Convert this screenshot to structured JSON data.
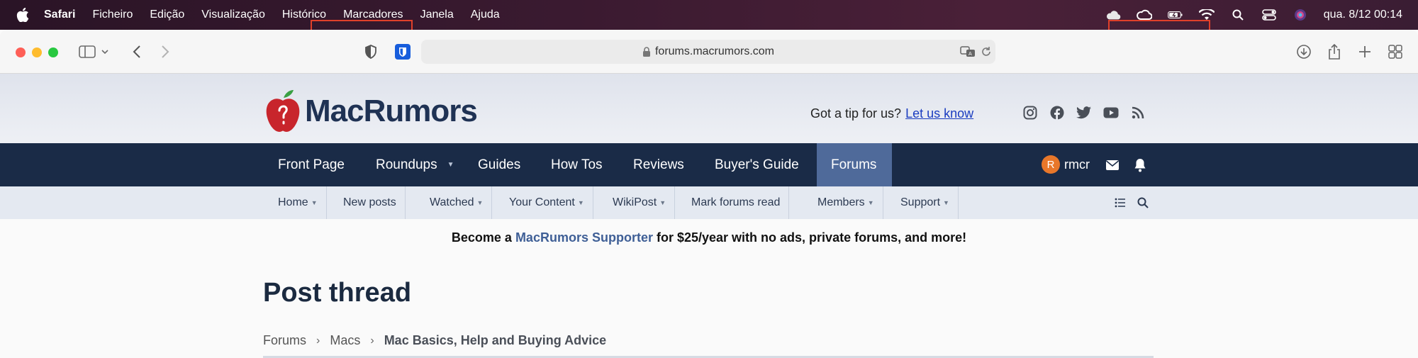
{
  "menubar": {
    "app": "Safari",
    "items": [
      "Ficheiro",
      "Edição",
      "Visualização",
      "Histórico",
      "Marcadores",
      "Janela",
      "Ajuda"
    ],
    "clock": "qua. 8/12  00:14"
  },
  "browser": {
    "url": "forums.macrumors.com"
  },
  "site": {
    "logo_text": "MacRumors",
    "tip_text": "Got a tip for us?",
    "tip_link": "Let us know",
    "nav": [
      "Front Page",
      "Roundups",
      "Guides",
      "How Tos",
      "Reviews",
      "Buyer's Guide",
      "Forums"
    ],
    "user_initial": "R",
    "username": "rmcr",
    "subnav": [
      "Home",
      "New posts",
      "Watched",
      "Your Content",
      "WikiPost",
      "Mark forums read",
      "Members",
      "Support"
    ]
  },
  "promo": {
    "before": "Become a",
    "link": "MacRumors Supporter",
    "after": "for $25/year with no ads, private forums, and more!"
  },
  "page": {
    "title": "Post thread",
    "breadcrumb": [
      "Forums",
      "Macs",
      "Mac Basics, Help and Buying Advice"
    ]
  },
  "colors": {
    "nav_bg": "#1a2b47",
    "nav_active": "#4f6a9a",
    "highlight": "#e0402a"
  }
}
